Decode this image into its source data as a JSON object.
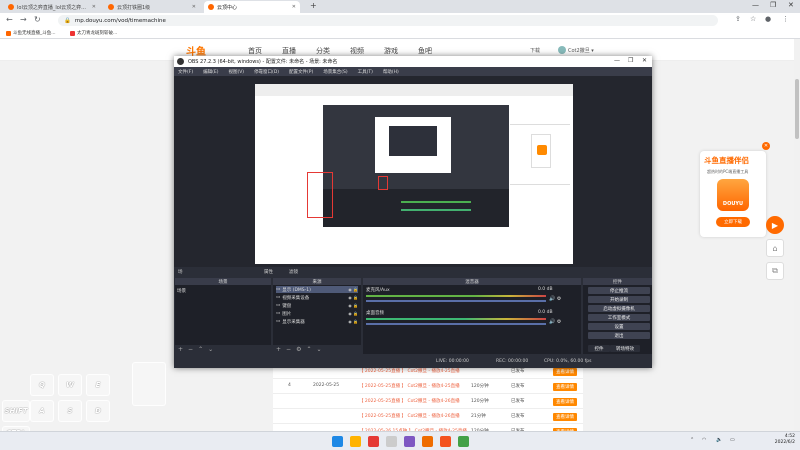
{
  "browser": {
    "tabs": [
      {
        "title": "lol云顶之弈直播_lol云顶之弈..."
      },
      {
        "title": "云顶打铁圈1级"
      },
      {
        "title": "云顶中心"
      }
    ],
    "url": "mp.douyu.com/vod/timemachine",
    "bookmarks": [
      "斗鱼无线直播_斗鱼...",
      "太刀青龙斑刻斩破..."
    ]
  },
  "douyu": {
    "logo": "斗鱼",
    "nav": [
      "首页",
      "直播",
      "分类",
      "视频",
      "游戏",
      "鱼吧"
    ],
    "header_right": [
      "下载",
      "Cot2撒旦 ▾"
    ],
    "history_rows": [
      {
        "date": "",
        "title": "【 2022-05-25直播 】 Cot2撒旦 - 播放4-25直播",
        "duration": "",
        "status": "已发布",
        "action": "查看详情"
      },
      {
        "index": "4",
        "date": "2022-05-25",
        "title": "【 2022-05-25直播 】 Cot2撒旦 - 播放4-25直播",
        "duration": "120分钟",
        "status": "已发布",
        "action": "查看详情"
      },
      {
        "date": "",
        "title": "【 2022-05-25直播 】 Cot2撒旦 - 播放4-26直播",
        "duration": "120分钟",
        "status": "已发布",
        "action": "查看详情"
      },
      {
        "date": "",
        "title": "【 2022-05-25直播 】 Cot2撒旦 - 播放4-26直播",
        "duration": "21分钟",
        "status": "已发布",
        "action": "查看详情"
      },
      {
        "date": "",
        "title": "【 2022-05-26 15点钟 】 Cot2撒旦 - 播放4-25直播",
        "duration": "120分钟",
        "status": "已发布",
        "action": "查看详情"
      }
    ],
    "ad": {
      "title": "斗鱼直播伴侣",
      "subtitle": "超热时的PC端直播工具",
      "icon_text": "DOUYU",
      "button": "立即下载"
    }
  },
  "obs": {
    "title": "OBS 27.2.3 (64-bit, windows) - 配置文件: 未命名 - 场景: 未命名",
    "menu": [
      "文件(F)",
      "编辑(E)",
      "视图(V)",
      "停靠窗口(D)",
      "配置文件(P)",
      "场景集合(S)",
      "工具(T)",
      "帮助(H)"
    ],
    "dockbar": {
      "left": "场",
      "props": "属性",
      "filters": "滤镜"
    },
    "scenes": {
      "header": "场景",
      "items": [
        "场景"
      ]
    },
    "sources": {
      "header": "来源",
      "items": [
        "显示 (DMS-1)",
        "视频采集设备",
        "键盘",
        "图片",
        "显示采集器"
      ]
    },
    "mixer": {
      "header": "混音器",
      "tracks": [
        {
          "name": "麦克风/Aux",
          "db": "0.0 dB",
          "color": "#63b345"
        },
        {
          "name": "桌面音频",
          "db": "0.0 dB",
          "color": "#3db873"
        }
      ]
    },
    "controls": {
      "header": "控件",
      "buttons": [
        "停止推流",
        "开始录制",
        "启动虚拟摄像机",
        "工作室模式",
        "设置",
        "退出"
      ],
      "tabs": [
        "控件",
        "转场特效"
      ]
    },
    "status": {
      "live": "LIVE: 00:00:00",
      "rec": "REC: 00:00:00",
      "cpu": "CPU: 0.0%, 60.00 fps"
    }
  },
  "keyboard_overlay": {
    "row1": [
      "Q",
      "W",
      "E"
    ],
    "row2": [
      "SHIFT",
      "A",
      "S",
      "D"
    ],
    "row3": [
      "CTRL"
    ]
  },
  "taskbar": {
    "time": "4:52",
    "date": "2022/6/2",
    "app_colors": [
      "#1e88e5",
      "#ffb300",
      "#e53935",
      "#7e57c2",
      "#ef6c00",
      "#f4511e",
      "#43a047"
    ]
  }
}
